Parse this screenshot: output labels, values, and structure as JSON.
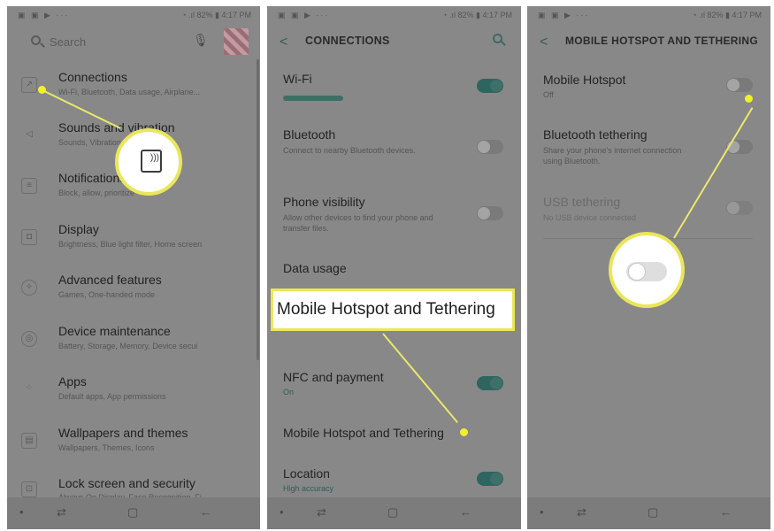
{
  "status_bar": {
    "left_icons": "▣ ▣ ▶ ···",
    "right_info": "◔ .ıl 82% ▮ 4:17 PM"
  },
  "nav_bar": {
    "dot": "•",
    "recent": "⇄",
    "home": "▢",
    "back": "←"
  },
  "panel1": {
    "search_placeholder": "Search",
    "mic_glyph": "🎙",
    "items": [
      {
        "title": "Connections",
        "subtitle": "Wi-Fi, Bluetooth, Data usage, Airplane...",
        "icon": "connections-icon",
        "glyph": "↗"
      },
      {
        "title": "Sounds and vibration",
        "subtitle": "Sounds, Vibration, Do not disturb",
        "icon": "speaker-icon",
        "glyph": "◁"
      },
      {
        "title": "Notifications",
        "subtitle": "Block, allow, prioritize",
        "icon": "notification-icon",
        "glyph": "≡"
      },
      {
        "title": "Display",
        "subtitle": "Brightness, Blue light filter, Home screen",
        "icon": "display-icon",
        "glyph": "◘"
      },
      {
        "title": "Advanced features",
        "subtitle": "Games, One-handed mode",
        "icon": "advanced-features-icon",
        "glyph": "✧"
      },
      {
        "title": "Device maintenance",
        "subtitle": "Battery, Storage, Memory, Device secui",
        "icon": "device-maintenance-icon",
        "glyph": "◎"
      },
      {
        "title": "Apps",
        "subtitle": "Default apps, App permissions",
        "icon": "apps-icon",
        "glyph": "⁘"
      },
      {
        "title": "Wallpapers and themes",
        "subtitle": "Wallpapers, Themes, Icons",
        "icon": "brush-icon",
        "glyph": "▤"
      },
      {
        "title": "Lock screen and security",
        "subtitle": "Always On Display, Face Recognition, Fi",
        "icon": "lock-icon",
        "glyph": "⊡"
      }
    ]
  },
  "panel2": {
    "title": "CONNECTIONS",
    "back_glyph": "<",
    "items": [
      {
        "title": "Wi-Fi",
        "subtitle": "",
        "toggle": true
      },
      {
        "title": "Bluetooth",
        "subtitle": "Connect to nearby Bluetooth devices.",
        "toggle": false
      },
      {
        "title": "Phone visibility",
        "subtitle": "Allow other devices to find your phone and transfer files.",
        "toggle": false
      },
      {
        "title": "Data usage",
        "subtitle": ""
      },
      {
        "title": "NFC and payment",
        "subtitle": "On",
        "toggle": true
      },
      {
        "title": "Mobile Hotspot and Tethering",
        "subtitle": ""
      },
      {
        "title": "Location",
        "subtitle": "High accuracy",
        "toggle": true
      }
    ],
    "callout_label": "Mobile Hotspot and Tethering"
  },
  "panel3": {
    "title": "MOBILE HOTSPOT AND TETHERING",
    "back_glyph": "<",
    "items": [
      {
        "title": "Mobile Hotspot",
        "subtitle": "Off",
        "toggle": false
      },
      {
        "title": "Bluetooth tethering",
        "subtitle": "Share your phone's internet connection using Bluetooth.",
        "toggle": false
      },
      {
        "title": "USB tethering",
        "subtitle": "No USB device connected",
        "toggle": false
      }
    ]
  },
  "colors": {
    "highlight": "#eae65a",
    "accent": "#2e6560"
  }
}
